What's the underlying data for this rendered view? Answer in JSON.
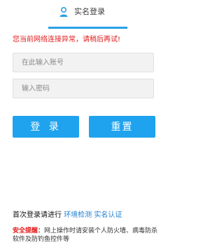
{
  "tab": {
    "label": "实名登录",
    "icon": "user-icon"
  },
  "error": {
    "message": "您当前网络连接异常，请稍后再试!"
  },
  "form": {
    "account_placeholder": "在此输入账号",
    "password_placeholder": "输入密码",
    "login_label": "登 录",
    "reset_label": "重置"
  },
  "footer": {
    "first_login_prefix": "首次登录请进行",
    "env_check_link": "环境检测",
    "realname_link": "实名认证",
    "safety_label": "安全提醒：",
    "safety_text": "网上操作时请安装个人防火墙、病毒防杀软件及防钓鱼控件等"
  },
  "colors": {
    "accent": "#20a3ee",
    "error": "#e31b1b",
    "link": "#1f7fd1"
  }
}
